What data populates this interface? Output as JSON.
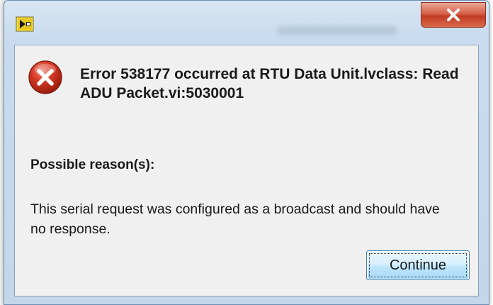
{
  "window": {
    "title": "",
    "app_icon": "labview-icon"
  },
  "title_bar": {
    "close_icon": "close-icon"
  },
  "dialog": {
    "error_icon": "error-icon",
    "error_message": "Error 538177 occurred at RTU Data Unit.lvclass: Read ADU Packet.vi:5030001",
    "reason_heading": "Possible reason(s):",
    "reason_text": "This serial request was configured as a broadcast and should have no response."
  },
  "buttons": {
    "continue_label": "Continue"
  },
  "colors": {
    "close_button": "#c23b22",
    "error_icon": "#c0301f",
    "dialog_bg": "#f0f0f0",
    "button_border": "#3c7fb1"
  }
}
